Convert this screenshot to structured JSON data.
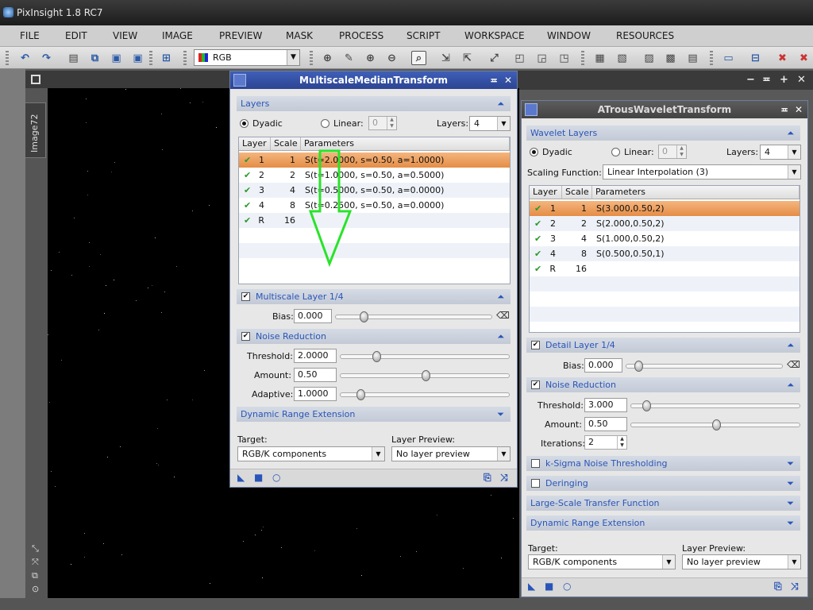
{
  "app": {
    "title": "PixInsight 1.8 RC7"
  },
  "menu": [
    "FILE",
    "EDIT",
    "VIEW",
    "IMAGE",
    "PREVIEW",
    "MASK",
    "PROCESS",
    "SCRIPT",
    "WORKSPACE",
    "WINDOW",
    "RESOURCES"
  ],
  "toolbar": {
    "color_space": "RGB"
  },
  "image_window": {
    "tab_label": "Image72"
  },
  "colors": {
    "title_active": "#2c4491",
    "selected_row": "#e58d45",
    "section_text": "#2a55b8",
    "checkmark": "#2c9a2c",
    "arrow": "#29e329"
  },
  "mmt": {
    "title": "MultiscaleMedianTransform",
    "layers_section": "Layers",
    "dyadic_label": "Dyadic",
    "linear_label": "Linear:",
    "linear_value": "0",
    "layers_label": "Layers:",
    "layers_value": "4",
    "columns": [
      "Layer",
      "Scale",
      "Parameters"
    ],
    "rows": [
      {
        "layer": "1",
        "scale": "1",
        "params": "S(t=2.0000, s=0.50, a=1.0000)"
      },
      {
        "layer": "2",
        "scale": "2",
        "params": "S(t=1.0000, s=0.50, a=0.5000)"
      },
      {
        "layer": "3",
        "scale": "4",
        "params": "S(t=0.5000, s=0.50, a=0.0000)"
      },
      {
        "layer": "4",
        "scale": "8",
        "params": "S(t=0.2500, s=0.50, a=0.0000)"
      },
      {
        "layer": "R",
        "scale": "16",
        "params": ""
      }
    ],
    "layer_section": "Multiscale Layer 1/4",
    "bias_label": "Bias:",
    "bias_value": "0.000",
    "noise_section": "Noise Reduction",
    "threshold_label": "Threshold:",
    "threshold_value": "2.0000",
    "amount_label": "Amount:",
    "amount_value": "0.50",
    "adaptive_label": "Adaptive:",
    "adaptive_value": "1.0000",
    "dre_section": "Dynamic Range Extension",
    "target_label": "Target:",
    "target_value": "RGB/K components",
    "preview_label": "Layer Preview:",
    "preview_value": "No layer preview"
  },
  "atw": {
    "title": "ATrousWaveletTransform",
    "layers_section": "Wavelet Layers",
    "dyadic_label": "Dyadic",
    "linear_label": "Linear:",
    "linear_value": "0",
    "layers_label": "Layers:",
    "layers_value": "4",
    "scaling_label": "Scaling Function:",
    "scaling_value": "Linear Interpolation (3)",
    "columns": [
      "Layer",
      "Scale",
      "Parameters"
    ],
    "rows": [
      {
        "layer": "1",
        "scale": "1",
        "params": "S(3.000,0.50,2)"
      },
      {
        "layer": "2",
        "scale": "2",
        "params": "S(2.000,0.50,2)"
      },
      {
        "layer": "3",
        "scale": "4",
        "params": "S(1.000,0.50,2)"
      },
      {
        "layer": "4",
        "scale": "8",
        "params": "S(0.500,0.50,1)"
      },
      {
        "layer": "R",
        "scale": "16",
        "params": ""
      }
    ],
    "detail_section": "Detail Layer 1/4",
    "bias_label": "Bias:",
    "bias_value": "0.000",
    "noise_section": "Noise Reduction",
    "threshold_label": "Threshold:",
    "threshold_value": "3.000",
    "amount_label": "Amount:",
    "amount_value": "0.50",
    "iterations_label": "Iterations:",
    "iterations_value": "2",
    "ksigma_section": "k-Sigma Noise Thresholding",
    "deringing_section": "Deringing",
    "lstf_section": "Large-Scale Transfer Function",
    "dre_section": "Dynamic Range Extension",
    "target_label": "Target:",
    "target_value": "RGB/K components",
    "preview_label": "Layer Preview:",
    "preview_value": "No layer preview"
  }
}
